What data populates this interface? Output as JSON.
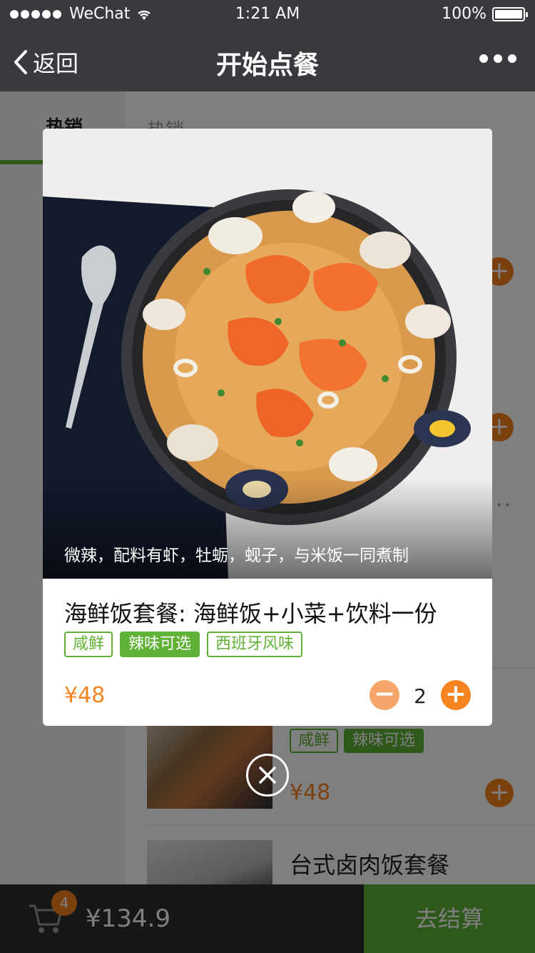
{
  "status": {
    "carrier": "WeChat",
    "time": "1:21 AM",
    "battery": "100%"
  },
  "nav": {
    "back_label": "返回",
    "title": "开始点餐"
  },
  "sidebar": {
    "items": [
      {
        "label": "热销"
      }
    ]
  },
  "content": {
    "section_header": "热销",
    "items": [
      {
        "tags": [
          "咸鲜",
          "辣味可选"
        ],
        "price": "¥48"
      },
      {
        "name": "台式卤肉饭套餐"
      }
    ]
  },
  "cart": {
    "count": "4",
    "total": "¥134.9",
    "checkout_label": "去结算"
  },
  "modal": {
    "caption": "微辣，配料有虾，牡蛎，蚬子，与米饭一同煮制",
    "title": "海鲜饭套餐: 海鲜饭+小菜+饮料一份",
    "tags": [
      {
        "label": "咸鲜",
        "style": "outline"
      },
      {
        "label": "辣味可选",
        "style": "filled"
      },
      {
        "label": "西班牙风味",
        "style": "outline"
      }
    ],
    "price": "¥48",
    "quantity": "2",
    "minus_symbol": "−",
    "plus_symbol": "+"
  },
  "colors": {
    "accent_green": "#5fb236",
    "accent_orange": "#f5831f",
    "nav_bg": "#393a3f"
  }
}
